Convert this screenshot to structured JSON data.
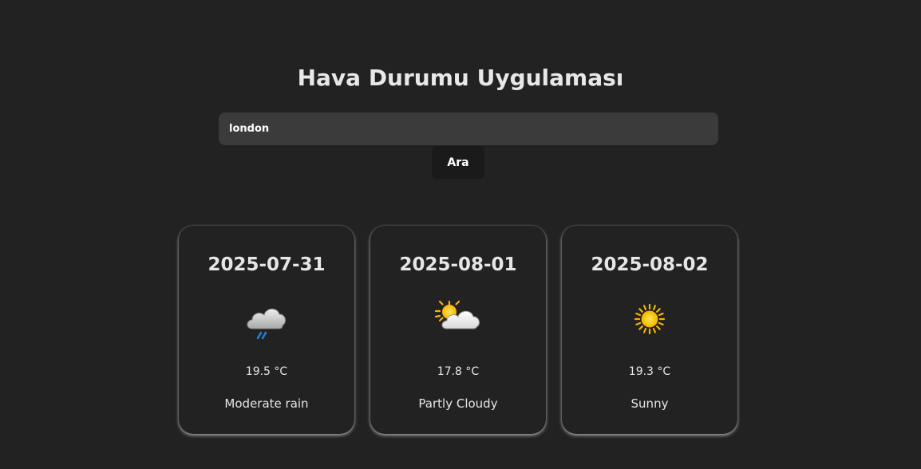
{
  "header": {
    "title": "Hava Durumu Uygulaması"
  },
  "search": {
    "value": "london",
    "button_label": "Ara"
  },
  "forecast": [
    {
      "date": "2025-07-31",
      "temperature": "19.5 °C",
      "condition": "Moderate rain",
      "icon": "rain-cloud-icon"
    },
    {
      "date": "2025-08-01",
      "temperature": "17.8 °C",
      "condition": "Partly Cloudy",
      "icon": "partly-cloudy-icon"
    },
    {
      "date": "2025-08-02",
      "temperature": "19.3 °C",
      "condition": "Sunny",
      "icon": "sun-icon"
    }
  ],
  "colors": {
    "background": "#222222",
    "input_background": "#3b3b3b",
    "button_background": "#1a1a1a",
    "text": "#e6e6e6",
    "sun": "#f6b400",
    "rain": "#2a7fd4"
  }
}
